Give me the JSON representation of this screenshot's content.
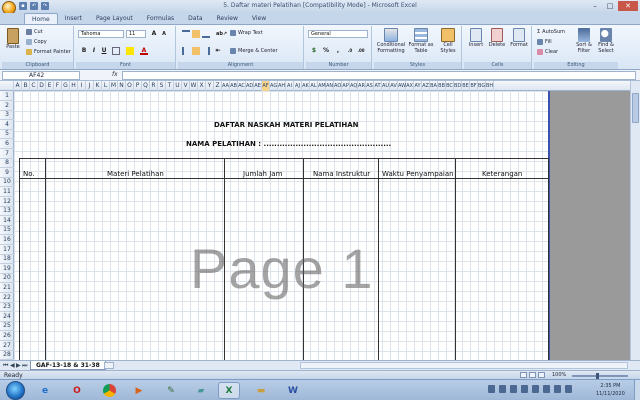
{
  "window": {
    "title": "5. Daftar materi Pelatihan  [Compatibility Mode] - Microsoft Excel"
  },
  "ribbon_tabs": [
    "Home",
    "Insert",
    "Page Layout",
    "Formulas",
    "Data",
    "Review",
    "View"
  ],
  "clipboard": {
    "paste": "Paste",
    "cut": "Cut",
    "copy": "Copy",
    "format_painter": "Format Painter",
    "group": "Clipboard"
  },
  "font": {
    "name": "Tahoma",
    "size": "11",
    "group": "Font",
    "bold": "B",
    "italic": "I",
    "underline": "U",
    "grow": "A",
    "shrink": "A"
  },
  "alignment": {
    "wrap_text": "Wrap Text",
    "merge_center": "Merge & Center",
    "group": "Alignment"
  },
  "number": {
    "format": "General",
    "currency": "$",
    "percent": "%",
    "comma": ",",
    "group": "Number"
  },
  "styles": {
    "conditional": "Conditional Formatting",
    "format_table": "Format as Table",
    "cell_styles": "Cell Styles",
    "group": "Styles"
  },
  "cells": {
    "insert": "Insert",
    "delete": "Delete",
    "format": "Format",
    "group": "Cells"
  },
  "editing": {
    "autosum": "AutoSum",
    "fill": "Fill",
    "clear": "Clear",
    "sort_filter": "Sort & Filter",
    "find_select": "Find & Select",
    "group": "Editing"
  },
  "formula_bar": {
    "name_box": "AF42",
    "fx": "fx",
    "value": ""
  },
  "columns": [
    "A",
    "B",
    "C",
    "D",
    "E",
    "F",
    "G",
    "H",
    "I",
    "J",
    "K",
    "L",
    "M",
    "N",
    "O",
    "P",
    "Q",
    "R",
    "S",
    "T",
    "U",
    "V",
    "W",
    "X",
    "Y",
    "Z",
    "AA",
    "AB",
    "AC",
    "AD",
    "AE",
    "AF",
    "AG",
    "AH",
    "AI",
    "AJ",
    "AK",
    "AL",
    "AM",
    "AN",
    "AO",
    "AP",
    "AQ",
    "AR",
    "AS",
    "AT",
    "AU",
    "AV",
    "AW",
    "AX",
    "AY",
    "AZ",
    "BA",
    "BB",
    "BC",
    "BD",
    "BE",
    "BF",
    "BG",
    "BH"
  ],
  "selected_column": "AF",
  "rows": [
    "1",
    "2",
    "3",
    "4",
    "5",
    "6",
    "7",
    "8",
    "9",
    "10",
    "11",
    "12",
    "13",
    "14",
    "15",
    "16",
    "17",
    "18",
    "19",
    "20",
    "21",
    "22",
    "23",
    "24",
    "25",
    "26",
    "27",
    "28"
  ],
  "document": {
    "title": "DAFTAR NASKAH MATERI PELATIHAN",
    "training_name": "NAMA  PELATIHAN : ................................................",
    "headers": [
      "No.",
      "Materi Pelatihan",
      "Jumlah Jam",
      "Nama Instruktur",
      "Waktu Penyampaian",
      "Keterangan"
    ]
  },
  "watermark": "Page 1",
  "sheet_tab": "GAF-13-18 & 31-38",
  "status": {
    "ready": "Ready",
    "zoom": "100%"
  },
  "taskbar": {
    "time": "2:35 PM",
    "date": "11/11/2020"
  }
}
